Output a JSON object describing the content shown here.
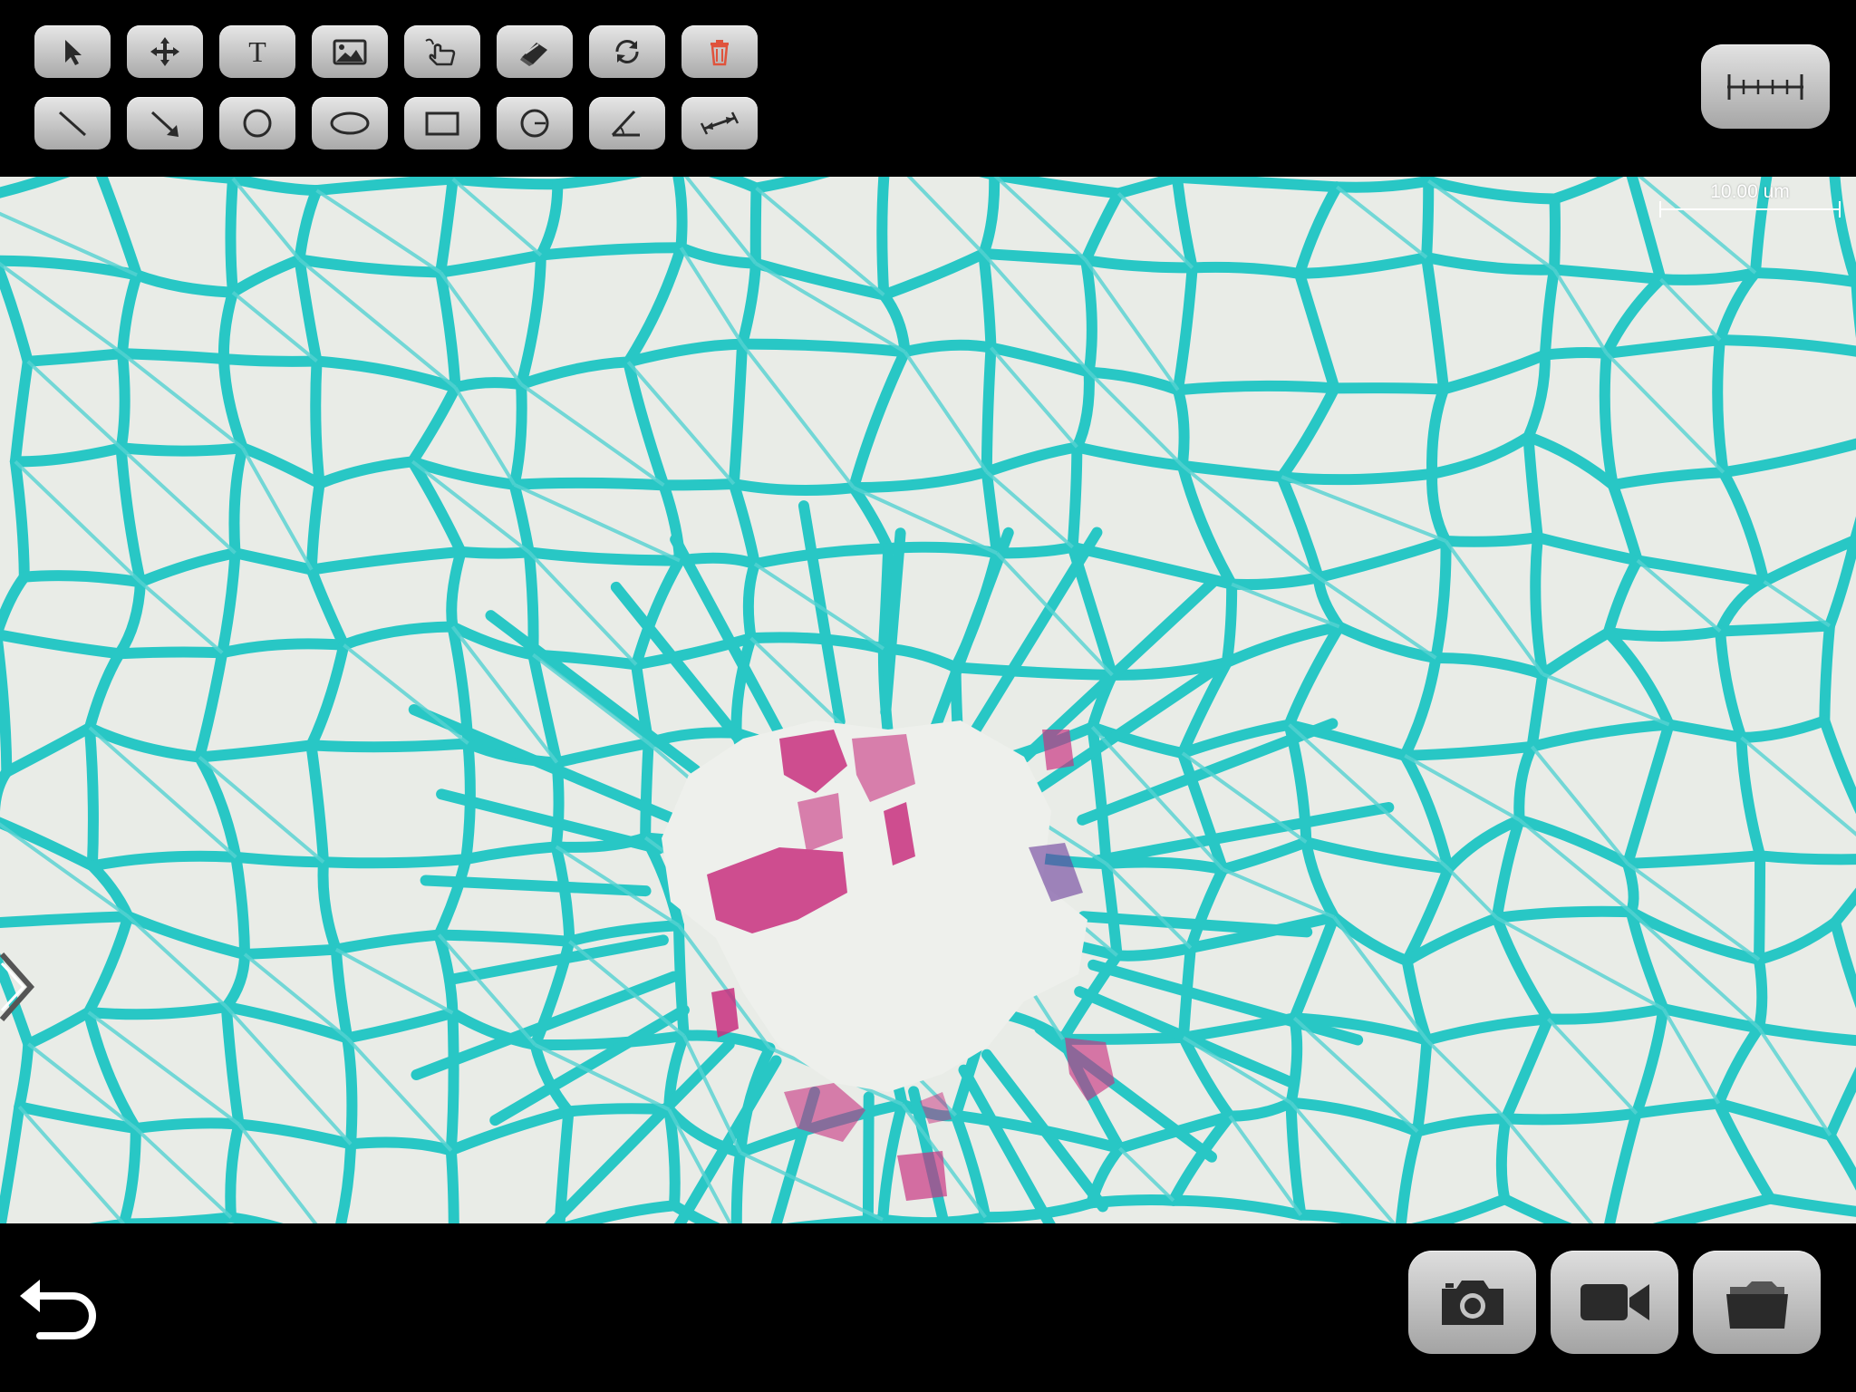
{
  "toolbar": {
    "row1": [
      {
        "name": "select-tool",
        "icon": "arrow-pointer-icon"
      },
      {
        "name": "move-tool",
        "icon": "move-arrows-icon"
      },
      {
        "name": "text-tool",
        "icon": "text-t-icon",
        "glyph": "T"
      },
      {
        "name": "image-tool",
        "icon": "image-icon"
      },
      {
        "name": "freehand-tool",
        "icon": "hand-draw-icon"
      },
      {
        "name": "eraser-tool",
        "icon": "eraser-icon"
      },
      {
        "name": "refresh-tool",
        "icon": "refresh-icon"
      },
      {
        "name": "delete-tool",
        "icon": "trash-icon"
      }
    ],
    "row2": [
      {
        "name": "line-tool",
        "icon": "line-icon"
      },
      {
        "name": "arrow-line-tool",
        "icon": "arrow-line-icon"
      },
      {
        "name": "circle-tool",
        "icon": "circle-icon"
      },
      {
        "name": "ellipse-tool",
        "icon": "ellipse-icon"
      },
      {
        "name": "rectangle-tool",
        "icon": "rectangle-icon"
      },
      {
        "name": "radius-circle-tool",
        "icon": "circle-radius-icon"
      },
      {
        "name": "angle-tool",
        "icon": "angle-icon"
      },
      {
        "name": "distance-tool",
        "icon": "distance-icon"
      }
    ],
    "ruler_icon": "ruler-icon"
  },
  "viewer": {
    "scale_label": "10.00 um"
  },
  "bottom": {
    "back_icon": "undo-back-icon",
    "camera_icon": "camera-icon",
    "video_icon": "video-camera-icon",
    "folder_icon": "folder-icon"
  },
  "colors": {
    "background": "#000000",
    "button_face": "#c8c8c8",
    "icon_dark": "#2a2a2a",
    "delete_red": "#e0533c",
    "specimen_background": "#e8ebe6",
    "cell_wall_cyan": "#19c7c6",
    "xylem_magenta": "#c8307f"
  }
}
